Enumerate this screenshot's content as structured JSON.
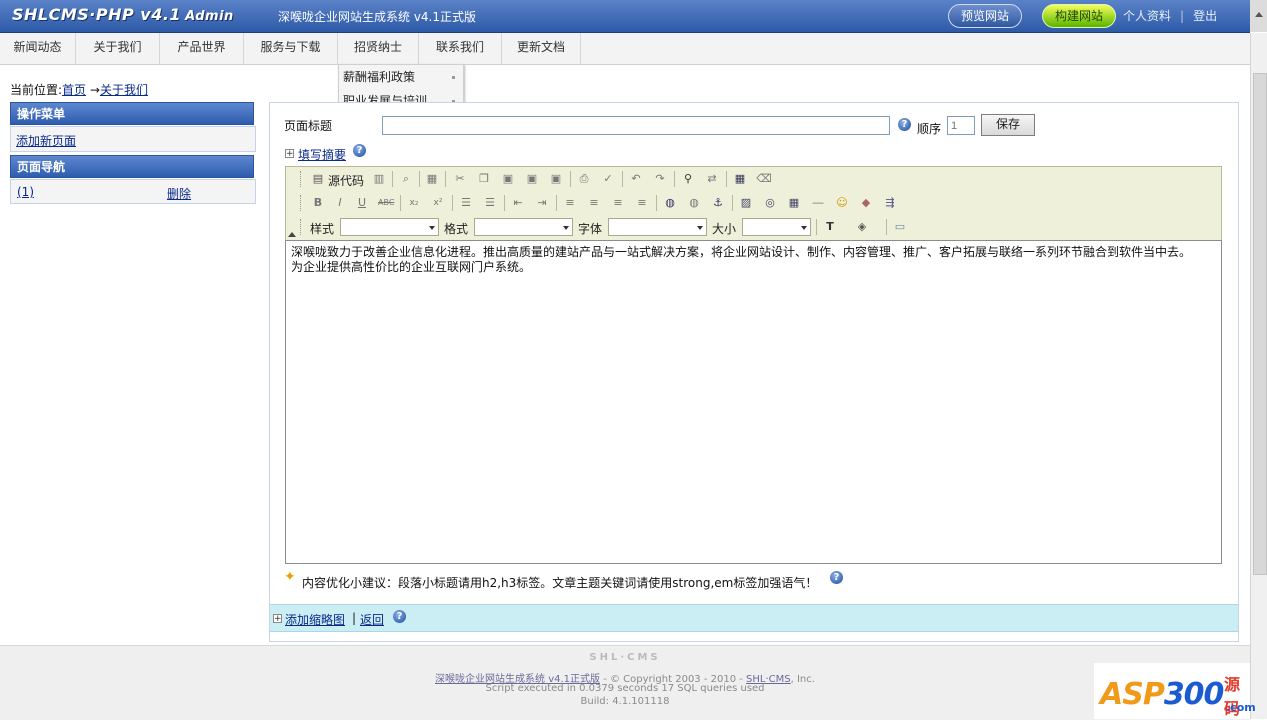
{
  "header": {
    "logo": "SHLCMS·PHP v4.1",
    "logo_suffix": "Admin",
    "system_name": "深喉咙企业网站生成系统  v4.1正式版",
    "preview_btn": "预览网站",
    "build_btn": "构建网站",
    "profile_link": "个人资料",
    "logout_link": "登出",
    "sep": "|"
  },
  "nav": {
    "items": [
      "新闻动态",
      "关于我们",
      "产品世界",
      "服务与下载",
      "招贤纳士",
      "联系我们",
      "更新文档"
    ],
    "dropdown": [
      "薪酬福利政策",
      "职业发展与培训"
    ]
  },
  "location": {
    "prefix": "当前位置:",
    "home": "首页",
    "arrow": "→",
    "current": "关于我们"
  },
  "left_panel": {
    "menu_title": "操作菜单",
    "add_page": "添加新页面",
    "nav_title": "页面导航",
    "page_link": "(1)",
    "delete_link": "删除"
  },
  "form": {
    "title_label": "页面标题",
    "title_value": "",
    "order_label": "顺序",
    "order_placeholder": "1",
    "save_btn": "保存",
    "summary_link": "填写摘要",
    "help_glyph": "?"
  },
  "editor": {
    "source_label": "源代码",
    "style_label": "样式",
    "format_label": "格式",
    "font_label": "字体",
    "size_label": "大小",
    "content_line1": "深喉咙致力于改善企业信息化进程。推出高质量的建站产品与一站式解决方案，将企业网站设计、制作、内容管理、推广、客户拓展与联络一系列环节融合到软件当中去。",
    "content_line2": "为企业提供高性价比的企业互联网门户系统。"
  },
  "tip": {
    "text": "内容优化小建议：段落小标题请用h2,h3标签。文章主题关键词请使用strong,em标签加强语气！"
  },
  "bottom": {
    "add_thumb": "添加缩略图",
    "sep": "|",
    "back": "返回"
  },
  "footer": {
    "brand": "SHL·CMS",
    "product_link": "深喉咙企业网站生成系统 v4.1正式版",
    "copyright_mid": " - © Copyright 2003 - 2010 - ",
    "shl_link": "SHL·CMS",
    "copyright_end": ", Inc.",
    "script_info": "Script executed in 0.0379 seconds 17 SQL queries used",
    "build": "Build: 4.1.101118"
  },
  "watermark": {
    "asp": "ASP",
    "num": "300",
    "yuan": "源码",
    "com": ".com"
  },
  "colors": {
    "header_blue": "#2d5aa8",
    "build_green": "#58b400",
    "bottom_bar": "#cbeef5"
  }
}
